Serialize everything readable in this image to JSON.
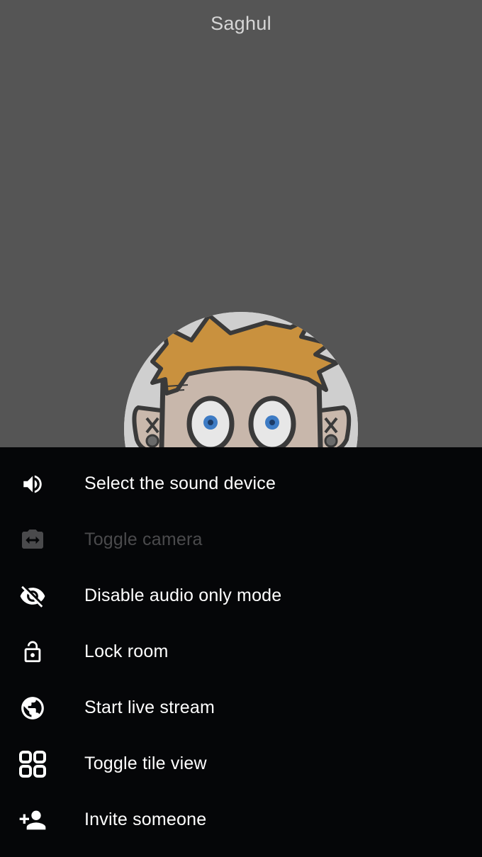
{
  "participant": {
    "name": "Saghul"
  },
  "menu": {
    "items": [
      {
        "label": "Select the sound device",
        "icon": "volume-icon",
        "disabled": false
      },
      {
        "label": "Toggle camera",
        "icon": "switch-camera-icon",
        "disabled": true
      },
      {
        "label": "Disable audio only mode",
        "icon": "eye-off-icon",
        "disabled": false
      },
      {
        "label": "Lock room",
        "icon": "unlock-icon",
        "disabled": false
      },
      {
        "label": "Start live stream",
        "icon": "globe-icon",
        "disabled": false
      },
      {
        "label": "Toggle tile view",
        "icon": "tile-view-icon",
        "disabled": false
      },
      {
        "label": "Invite someone",
        "icon": "add-person-icon",
        "disabled": false
      }
    ]
  },
  "colors": {
    "stage_background": "#555555",
    "sheet_background": "#050608",
    "label_text": "#ffffff",
    "disabled_text": "#4a4a4c",
    "avatar_hair": "#c9913e"
  }
}
